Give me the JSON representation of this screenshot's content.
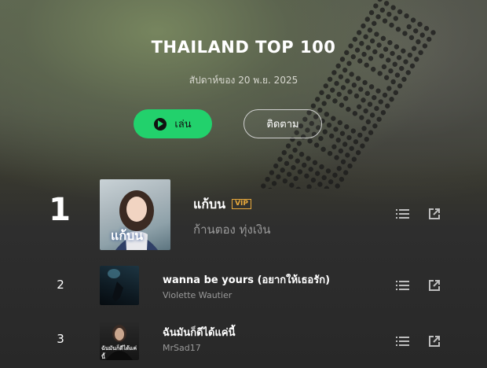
{
  "header": {
    "title": "THAILAND TOP 100",
    "subtitle": "สัปดาห์ของ 20 พ.ย. 2025",
    "play_label": "เล่น",
    "follow_label": "ติดตาม"
  },
  "tracks": [
    {
      "rank": "1",
      "title": "แก้บน",
      "badge": "VIP",
      "artist": "ก้านตอง ทุ่งเงิน",
      "cover_text": "แก้บน"
    },
    {
      "rank": "2",
      "title": "wanna be yours (อยากให้เธอรัก)",
      "artist": "Violette Wautier"
    },
    {
      "rank": "3",
      "title": "ฉันมันก็ดีได้แค่นี้",
      "artist": "MrSad17",
      "cover_text": "ฉันมันก็ดีได้แค่นี้"
    }
  ],
  "icons": {
    "play": "play-icon",
    "queue": "queue-list-icon",
    "share": "share-external-icon"
  },
  "colors": {
    "accent_green": "#22d16c",
    "vip_badge": "#e9a93b"
  }
}
